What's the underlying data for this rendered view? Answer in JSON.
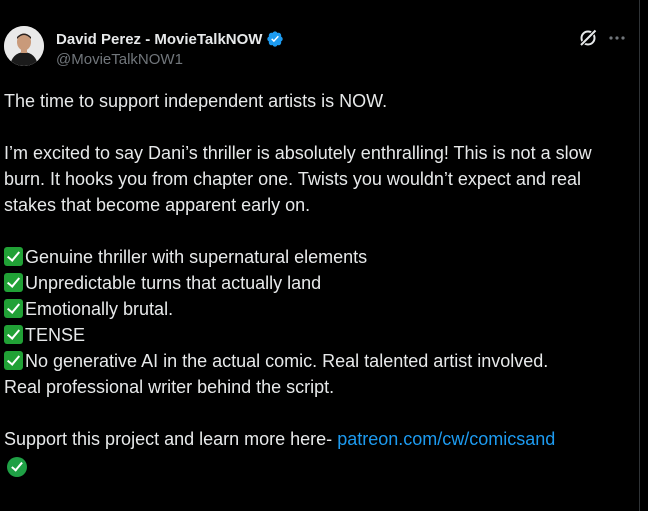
{
  "tweet": {
    "author": {
      "display_name": "David Perez - MovieTalkNOW",
      "handle": "@MovieTalkNOW1",
      "verified": true,
      "avatar_icon": "user-avatar-photo"
    },
    "actions": {
      "grok_icon": "grok-slash-icon",
      "more_icon": "more-dots-icon"
    },
    "body": {
      "intro": "The time to support independent artists is NOW.",
      "paragraph": "I’m excited to say Dani’s thriller is absolutely enthralling!  This is not a slow burn. It hooks you from chapter one. Twists you wouldn’t expect and real stakes that become apparent early on.",
      "bullets": [
        "Genuine thriller with supernatural elements",
        "Unpredictable turns that actually land",
        "Emotionally brutal.",
        "TENSE",
        "No generative AI in the actual comic. Real talented artist involved."
      ],
      "bullet_continuation": "Real professional writer behind the script.",
      "support_prefix": "Support this project and learn more here- ",
      "link_text": "patreon.com/cw/comicsand"
    },
    "colors": {
      "background": "#000000",
      "text": "#e7e9ea",
      "secondary": "#71767b",
      "link": "#1d9bf0",
      "verified": "#1d9bf0",
      "check": "#21a136"
    }
  }
}
